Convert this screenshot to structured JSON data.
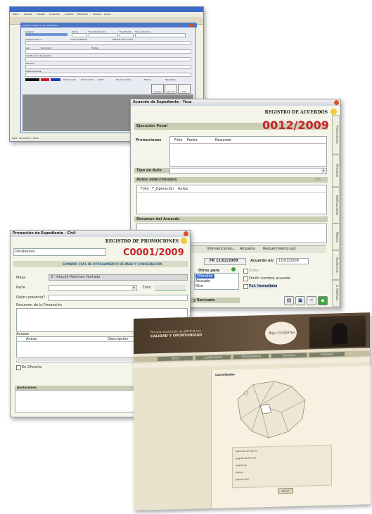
{
  "win1": {
    "menu": [
      "Datos",
      "Agenda",
      "Expedie",
      "Consultas",
      "Listados",
      "Mantenim",
      "Ventana",
      "Ayuda"
    ],
    "status": "Lista · Ver versión / datos",
    "dialog_title": "Detalle Audiencia de Expediente",
    "fields": [
      "Juzgado",
      "Fecha",
      "Hora Resolución",
      "Expediente",
      "Tipo Audiencia",
      "Juzgado Letra A",
      "Importe Materia",
      "Materia Prim Causa",
      "Juez",
      "Secretario",
      "Testigo",
      "Clasificación del Juzgado",
      "Ofendido",
      "Observaciones"
    ],
    "checks": [
      "Primera Vez",
      "Primera Des",
      "Notif.",
      "Es Concordad",
      "Fallece",
      "Ejecutada"
    ],
    "buttons": [
      "Aceptar",
      "Cancelar",
      "Salir"
    ]
  },
  "win2": {
    "title": "Acuerdo de Expediente - Toca",
    "heading": "REGISTRO DE ACUERDOS",
    "section": "Ejecución Penal",
    "number": "0012/2009",
    "promos_label": "Promociones",
    "promo_cols": [
      "Folio",
      "Fecha",
      "Resumen"
    ],
    "tipo_auto": "Tipo de Auto",
    "autos_sel": "Autos seleccionados",
    "autos_cols": [
      "Folio",
      "T_Operación",
      "Autos"
    ],
    "resumen": "Resumen del Acuerdo",
    "tabs": [
      "Intervenciones...",
      "Amparos",
      "Requerimiento Jud."
    ],
    "fecha_label": "FR 11/02/2009",
    "acuerdo_label": "Acuerdo en:",
    "acuerdo_value": "11/02/2009",
    "list_label": "Otros para",
    "list_items": [
      "Ofendido",
      "Acusado",
      "Otro"
    ],
    "checks": [
      "Turno",
      "Omitir nombre acusado",
      "Fol. Inmediata"
    ],
    "revision": "y Revisado",
    "vtabs": [
      "Promociones",
      "Personas",
      "Notificaciones",
      "Valores",
      "Audiencias",
      "S. Notificac."
    ]
  },
  "win3": {
    "title": "Promoción de Expediente - Civil",
    "heading": "REGISTRO DE PROMOCIONES",
    "tab": "Pendientes",
    "number": "C0001/2009",
    "subtitle": "SUMARIO CIVIL DE OTORGAMIENTO DE PAGO Y CONSIGNACIÓN",
    "mesa_label": "Mesa",
    "mesa_value": "3 - Araceli Martínez Hurtado",
    "parte_label": "Parte",
    "folio_label": "Folio",
    "quien_label": "Quien presenta?",
    "resumen_label": "Resumen de la Promoción",
    "anexos_label": "Anexos",
    "anexo_cols": [
      "Anexo",
      "Descripción"
    ],
    "oficialia": "En Oficialía",
    "bottom_label": "Anotaciones"
  },
  "web": {
    "banner_line1": "Por una impartición de JUSTICIA con",
    "banner_line2": "CALIDAD Y OPORTUNIDAD",
    "logo": "Baja California",
    "nav": [
      "Inicio",
      "Institucional",
      "Transparencia",
      "Servicios",
      "Contacto"
    ],
    "map_title": "Consultados",
    "info_rows": [
      "Municipio de Tijuana",
      "Juzgado de Primera",
      "Sala Penal",
      "Edificio",
      "Sección Civil"
    ],
    "button": "Buscar"
  }
}
